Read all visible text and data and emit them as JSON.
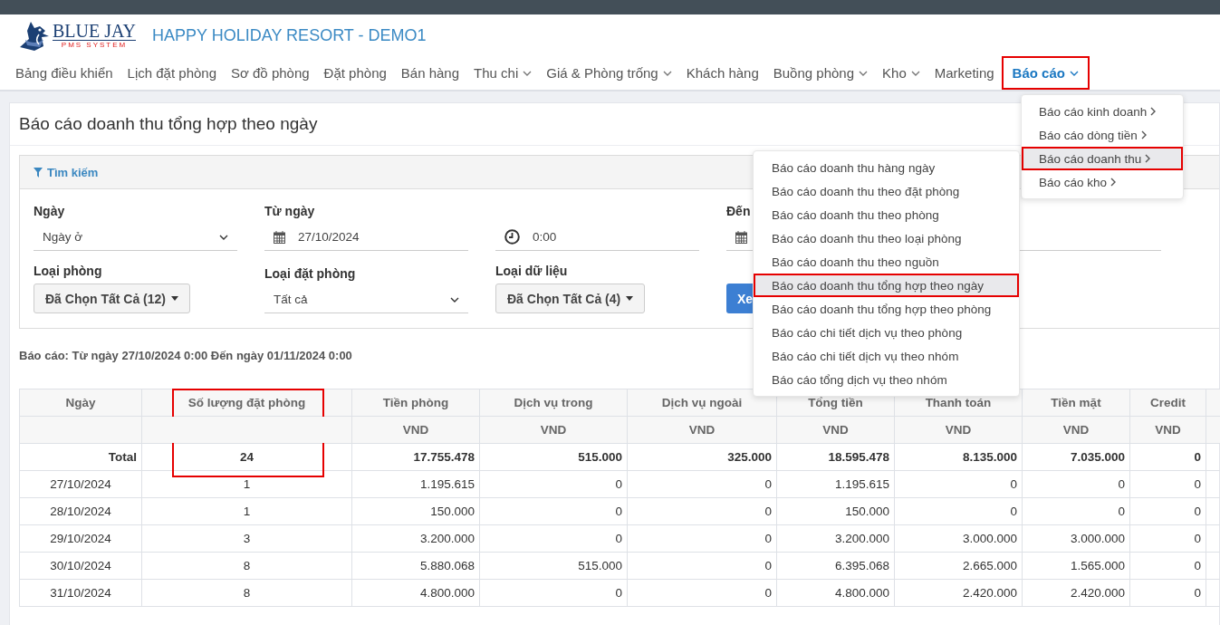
{
  "logo": {
    "name": "BLUE JAY",
    "tagline": "PMS SYSTEM"
  },
  "hotel_title": "HAPPY HOLIDAY RESORT - DEMO1",
  "nav": [
    {
      "label": "Bảng điều khiển",
      "dropdown": false,
      "selected": false,
      "highlighted": false
    },
    {
      "label": "Lịch đặt phòng",
      "dropdown": false,
      "selected": false,
      "highlighted": false
    },
    {
      "label": "Sơ đồ phòng",
      "dropdown": false,
      "selected": false,
      "highlighted": false
    },
    {
      "label": "Đặt phòng",
      "dropdown": false,
      "selected": false,
      "highlighted": false
    },
    {
      "label": "Bán hàng",
      "dropdown": false,
      "selected": false,
      "highlighted": false
    },
    {
      "label": "Thu chi",
      "dropdown": true,
      "selected": false,
      "highlighted": false
    },
    {
      "label": "Giá & Phòng trống",
      "dropdown": true,
      "selected": false,
      "highlighted": false
    },
    {
      "label": "Khách hàng",
      "dropdown": false,
      "selected": false,
      "highlighted": false
    },
    {
      "label": "Buồng phòng",
      "dropdown": true,
      "selected": false,
      "highlighted": false
    },
    {
      "label": "Kho",
      "dropdown": true,
      "selected": false,
      "highlighted": false
    },
    {
      "label": "Marketing",
      "dropdown": false,
      "selected": false,
      "highlighted": false
    },
    {
      "label": "Báo cáo",
      "dropdown": true,
      "selected": true,
      "highlighted": true
    }
  ],
  "page_title": "Báo cáo doanh thu tổng hợp theo ngày",
  "search": {
    "title": "Tìm kiếm",
    "fields": [
      {
        "kind": "select",
        "label": "Ngày",
        "value": "Ngày ở"
      },
      {
        "kind": "date",
        "label": "Từ ngày",
        "value": "27/10/2024"
      },
      {
        "kind": "time",
        "value": "0:00"
      },
      {
        "kind": "date",
        "label": "Đến"
      },
      {
        "kind": "line"
      },
      {
        "kind": "multiselect",
        "label": "Loại phòng",
        "value": "Đã Chọn Tất Cả (12)"
      },
      {
        "kind": "select",
        "label": "Loại đặt phòng",
        "value": "Tất cả"
      },
      {
        "kind": "multiselect",
        "label": "Loại dữ liệu",
        "value": "Đã Chọn Tất Cả (4)"
      },
      {
        "kind": "button",
        "value": "Xe"
      }
    ]
  },
  "report_caption": "Báo cáo: Từ ngày 27/10/2024 0:00 Đến ngày 01/11/2024 0:00",
  "table": {
    "columns": [
      {
        "label": "Ngày",
        "highlighted": false
      },
      {
        "label": "Số lượng đặt phòng",
        "highlighted": true
      },
      {
        "label": "Tiền phòng",
        "unit": "VND",
        "highlighted": false
      },
      {
        "label": "Dịch vụ trong",
        "unit": "VND",
        "highlighted": false
      },
      {
        "label": "Dịch vụ ngoài",
        "unit": "VND",
        "highlighted": false
      },
      {
        "label": "Tổng tiền",
        "unit": "VND",
        "highlighted": false
      },
      {
        "label": "Thanh toán",
        "unit": "VND",
        "highlighted": false
      },
      {
        "label": "Tiền mặt",
        "unit": "VND",
        "highlighted": false
      },
      {
        "label": "Credit",
        "unit": "VND",
        "highlighted": false
      }
    ],
    "total_row": [
      "Total",
      "24",
      "17.755.478",
      "515.000",
      "325.000",
      "18.595.478",
      "8.135.000",
      "7.035.000",
      "0"
    ],
    "rows": [
      [
        "27/10/2024",
        "1",
        "1.195.615",
        "0",
        "0",
        "1.195.615",
        "0",
        "0",
        "0"
      ],
      [
        "28/10/2024",
        "1",
        "150.000",
        "0",
        "0",
        "150.000",
        "0",
        "0",
        "0"
      ],
      [
        "29/10/2024",
        "3",
        "3.200.000",
        "0",
        "0",
        "3.200.000",
        "3.000.000",
        "3.000.000",
        "0"
      ],
      [
        "30/10/2024",
        "8",
        "5.880.068",
        "515.000",
        "0",
        "6.395.068",
        "2.665.000",
        "1.565.000",
        "0"
      ],
      [
        "31/10/2024",
        "8",
        "4.800.000",
        "0",
        "0",
        "4.800.000",
        "2.420.000",
        "2.420.000",
        "0"
      ]
    ]
  },
  "report_menu": {
    "items": [
      {
        "label": "Báo cáo kinh doanh",
        "selected": false,
        "highlighted": false
      },
      {
        "label": "Báo cáo dòng tiền",
        "selected": false,
        "highlighted": false
      },
      {
        "label": "Báo cáo doanh thu",
        "selected": true,
        "highlighted": true
      },
      {
        "label": "Báo cáo kho",
        "selected": false,
        "highlighted": false
      }
    ]
  },
  "revenue_submenu": {
    "items": [
      {
        "label": "Báo cáo doanh thu hàng ngày",
        "selected": false,
        "highlighted": false
      },
      {
        "label": "Báo cáo doanh thu theo đặt phòng",
        "selected": false,
        "highlighted": false
      },
      {
        "label": "Báo cáo doanh thu theo phòng",
        "selected": false,
        "highlighted": false
      },
      {
        "label": "Báo cáo doanh thu theo loại phòng",
        "selected": false,
        "highlighted": false
      },
      {
        "label": "Báo cáo doanh thu theo nguồn",
        "selected": false,
        "highlighted": false
      },
      {
        "label": "Báo cáo doanh thu tổng hợp theo ngày",
        "selected": true,
        "highlighted": true
      },
      {
        "label": "Báo cáo doanh thu tổng hợp theo phòng",
        "selected": false,
        "highlighted": false
      },
      {
        "label": "Báo cáo chi tiết dịch vụ theo phòng",
        "selected": false,
        "highlighted": false
      },
      {
        "label": "Báo cáo chi tiết dịch vụ theo nhóm",
        "selected": false,
        "highlighted": false
      },
      {
        "label": "Báo cáo tổng dịch vụ theo nhóm",
        "selected": false,
        "highlighted": false
      }
    ]
  }
}
